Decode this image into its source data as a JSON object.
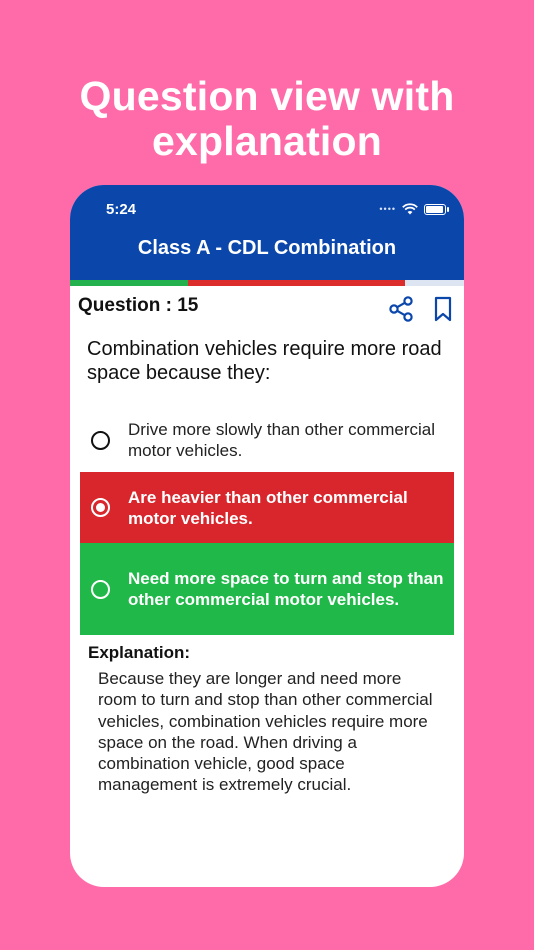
{
  "headline": {
    "line1": "Question view with",
    "line2": "explanation"
  },
  "status_bar": {
    "time": "5:24"
  },
  "app_bar": {
    "title": "Class A - CDL Combination"
  },
  "progress_bar": {
    "correct_fraction": 0.3,
    "wrong_fraction": 0.55
  },
  "question": {
    "header": "Question : 15",
    "text": "Combination vehicles require more road space because they:",
    "options": [
      {
        "text": "Drive more slowly than other commercial motor vehicles.",
        "state": "unselected"
      },
      {
        "text": "Are heavier than other commercial motor vehicles.",
        "state": "selected-wrong"
      },
      {
        "text": "Need more space to turn and stop than other commercial motor vehicles.",
        "state": "correct"
      }
    ]
  },
  "explanation": {
    "title": "Explanation:",
    "text": "Because they are longer and need more room to turn and stop than other commercial vehicles, combination vehicles require more space on the road. When driving a combination vehicle, good space management is extremely crucial."
  },
  "icons": {
    "share": "share-icon",
    "bookmark": "bookmark-icon"
  },
  "colors": {
    "background": "#FF6BA8",
    "app_bar": "#0B47AB",
    "wrong": "#D8262C",
    "correct": "#21B84A"
  }
}
